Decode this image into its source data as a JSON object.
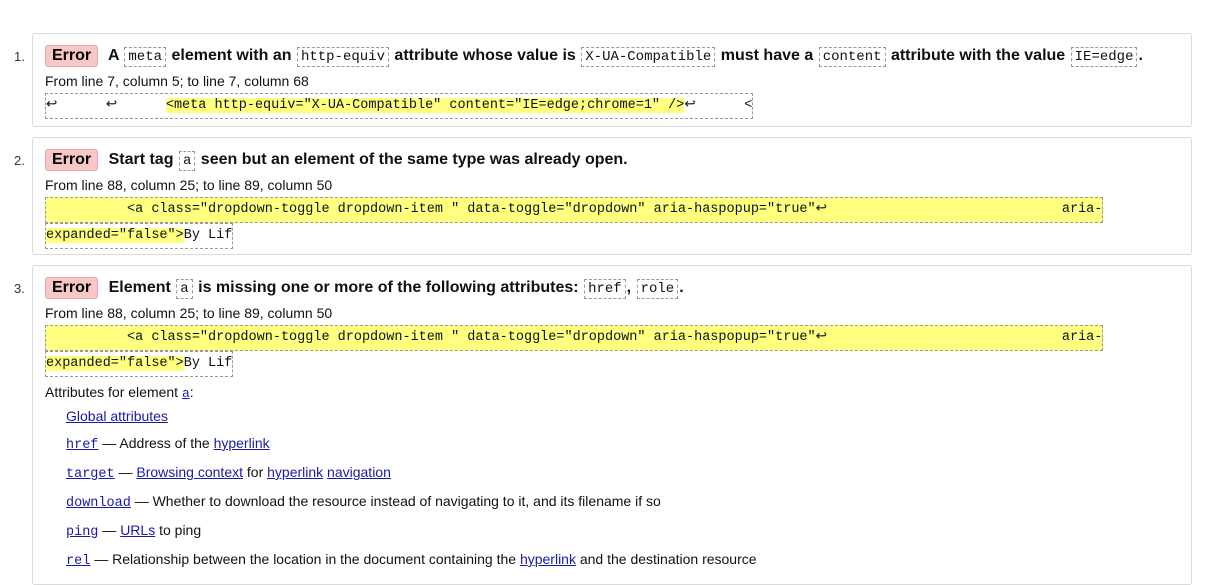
{
  "messages": [
    {
      "number": "1.",
      "type": "Error",
      "parts": [
        "A",
        "meta",
        "element with an",
        "http-equiv",
        "attribute whose value is",
        "X-UA-Compatible",
        "must have a",
        "content",
        "attribute with the value",
        "IE=edge",
        "."
      ],
      "location": "From line 7, column 5; to line 7, column 68",
      "extract_pre": "↩      ↩      ",
      "extract_hl": "<meta http-equiv=\"X-UA-Compatible\" content=\"IE=edge;chrome=1\" />",
      "extract_post": "↩      <"
    },
    {
      "number": "2.",
      "type": "Error",
      "parts": [
        "Start tag",
        "a",
        "seen but an element of the same type was already open."
      ],
      "location": "From line 88, column 25; to line 89, column 50",
      "extract_line1": "          <a class=\"dropdown-toggle dropdown-item \" data-toggle=\"dropdown\" aria-haspopup=\"true\"↩                             aria-",
      "extract_line2_hl": "expanded=\"false\">",
      "extract_line2_post": "By Lif"
    },
    {
      "number": "3.",
      "type": "Error",
      "parts": [
        "Element",
        "a",
        "is missing one or more of the following attributes:",
        "href",
        ",",
        "role",
        "."
      ],
      "location": "From line 88, column 25; to line 89, column 50",
      "extract_line1": "          <a class=\"dropdown-toggle dropdown-item \" data-toggle=\"dropdown\" aria-haspopup=\"true\"↩                             aria-",
      "extract_line2_hl": "expanded=\"false\">",
      "extract_line2_post": "By Lif",
      "attributes_label": "Attributes for element",
      "attributes_element": "a",
      "attributes_colon": ":",
      "global_attributes": "Global attributes",
      "attributes": [
        {
          "name": "href",
          "dash": " — Address of the ",
          "links": [
            "hyperlink"
          ],
          "rest": ""
        },
        {
          "name": "target",
          "dash": " — ",
          "links": [
            "Browsing context"
          ],
          "mid": " for ",
          "links2": [
            "hyperlink",
            "navigation"
          ],
          "rest": ""
        },
        {
          "name": "download",
          "dash": " — Whether to download the resource instead of navigating to it, and its filename if so",
          "links": [],
          "rest": ""
        },
        {
          "name": "ping",
          "dash": " — ",
          "links": [
            "URLs"
          ],
          "rest": " to ping"
        },
        {
          "name": "rel",
          "dash": " — Relationship between the location in the document containing the ",
          "links": [
            "hyperlink"
          ],
          "rest": " and the destination resource"
        }
      ]
    }
  ]
}
